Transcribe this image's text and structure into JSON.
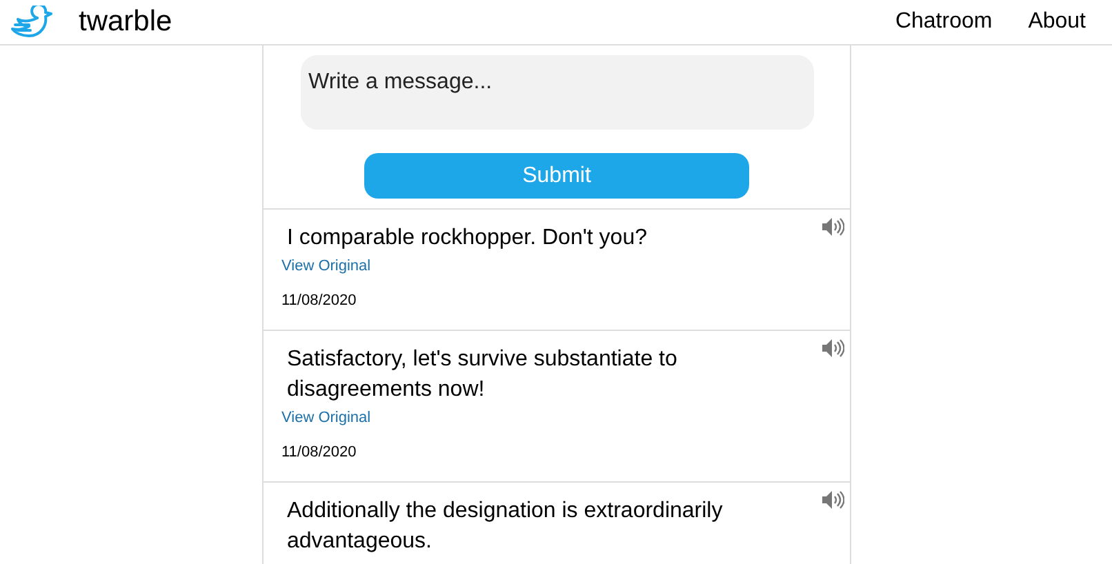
{
  "header": {
    "brand": "twarble",
    "nav": [
      "Chatroom",
      "About"
    ]
  },
  "composer": {
    "placeholder": "Write a message...",
    "submit": "Submit"
  },
  "messages": [
    {
      "text": "I comparable rockhopper. Don't you?",
      "link": "View Original",
      "date": "11/08/2020"
    },
    {
      "text": "Satisfactory, let's survive substantiate to disagreements now!",
      "link": "View Original",
      "date": "11/08/2020"
    },
    {
      "text": "Additionally the designation is extraordinarily advantageous."
    }
  ]
}
